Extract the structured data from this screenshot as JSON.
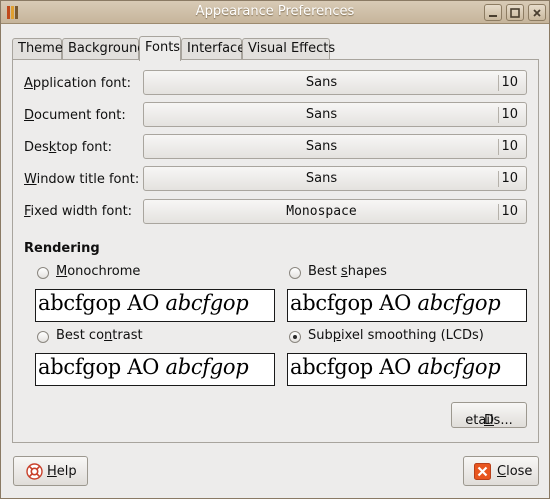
{
  "window": {
    "title": "Appearance Preferences"
  },
  "tabs": [
    {
      "label": "Theme"
    },
    {
      "label": "Background"
    },
    {
      "label": "Fonts"
    },
    {
      "label": "Interface"
    },
    {
      "label": "Visual Effects"
    }
  ],
  "fonts": [
    {
      "label_pre": "",
      "label_ul": "A",
      "label_post": "pplication font:",
      "name": "Sans",
      "size": "10"
    },
    {
      "label_pre": "",
      "label_ul": "D",
      "label_post": "ocument font:",
      "name": "Sans",
      "size": "10"
    },
    {
      "label_pre": "Des",
      "label_ul": "k",
      "label_post": "top font:",
      "name": "Sans",
      "size": "10"
    },
    {
      "label_pre": "",
      "label_ul": "W",
      "label_post": "indow title font:",
      "name": "Sans",
      "size": "10"
    },
    {
      "label_pre": "",
      "label_ul": "F",
      "label_post": "ixed width font:",
      "name": "Monospace",
      "size": "10"
    }
  ],
  "rendering": {
    "title": "Rendering",
    "options": [
      {
        "label_pre": "",
        "label_ul": "M",
        "label_post": "onochrome",
        "checked": false
      },
      {
        "label_pre": "Best ",
        "label_ul": "s",
        "label_post": "hapes",
        "checked": false
      },
      {
        "label_pre": "Best co",
        "label_ul": "n",
        "label_post": "trast",
        "checked": false
      },
      {
        "label_pre": "Sub",
        "label_ul": "p",
        "label_post": "ixel smoothing (LCDs)",
        "checked": true
      }
    ],
    "preview_regular": "abcfgop AO ",
    "preview_italic": "abcfgop"
  },
  "buttons": {
    "details_pre": "",
    "details_ul": "D",
    "details_post": "etails...",
    "help_pre": "",
    "help_ul": "H",
    "help_post": "elp",
    "close_pre": "",
    "close_ul": "C",
    "close_post": "lose"
  },
  "icons": {
    "app": "appearance-icon",
    "minimize": "minimize-icon",
    "maximize": "maximize-icon",
    "close_window": "close-window-icon",
    "help": "help-icon",
    "close": "close-icon"
  },
  "colors": {
    "titlebar": "#c6b59b",
    "close_icon": "#e8561f"
  }
}
